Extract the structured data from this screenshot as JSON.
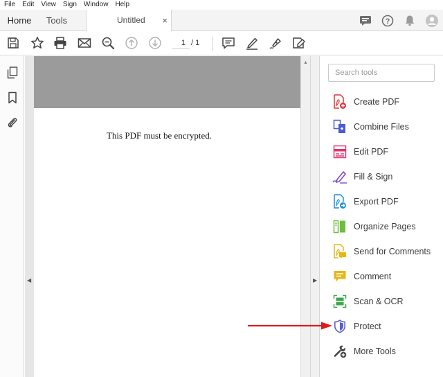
{
  "menu": [
    "File",
    "Edit",
    "View",
    "Sign",
    "Window",
    "Help"
  ],
  "tabs": {
    "home": "Home",
    "tools": "Tools",
    "document": "Untitled",
    "close": "×"
  },
  "header_icons": [
    "comment-bubble-icon",
    "help-icon",
    "bell-icon",
    "user-avatar-icon"
  ],
  "toolbar": {
    "icons": [
      "save-icon",
      "star-icon",
      "print-icon",
      "email-icon",
      "zoom-search-icon",
      "page-up-icon",
      "page-down-icon",
      "comment-icon",
      "highlight-pen-icon",
      "sign-pen-icon",
      "send-sign-icon"
    ],
    "page_current": "1",
    "page_total": "/ 1"
  },
  "left_nav_icons": [
    "page-thumbnails-icon",
    "bookmark-icon",
    "attachment-icon"
  ],
  "document": {
    "text": "This PDF must be encrypted."
  },
  "tools_pane": {
    "search_placeholder": "Search tools",
    "items": [
      {
        "label": "Create PDF",
        "icon": "create-pdf-icon",
        "color": "#e0353e"
      },
      {
        "label": "Combine Files",
        "icon": "combine-files-icon",
        "color": "#4a5bd6"
      },
      {
        "label": "Edit PDF",
        "icon": "edit-pdf-icon",
        "color": "#e0356e"
      },
      {
        "label": "Fill & Sign",
        "icon": "fill-sign-icon",
        "color": "#7c4bd6"
      },
      {
        "label": "Export PDF",
        "icon": "export-pdf-icon",
        "color": "#1b8fd6"
      },
      {
        "label": "Organize Pages",
        "icon": "organize-pages-icon",
        "color": "#6cbf3c"
      },
      {
        "label": "Send for Comments",
        "icon": "send-for-comments-icon",
        "color": "#e8b618"
      },
      {
        "label": "Comment",
        "icon": "comment-tool-icon",
        "color": "#e8b618"
      },
      {
        "label": "Scan & OCR",
        "icon": "scan-ocr-icon",
        "color": "#3aa84a"
      },
      {
        "label": "Protect",
        "icon": "protect-shield-icon",
        "color": "#5b5fc7"
      },
      {
        "label": "More Tools",
        "icon": "more-tools-icon",
        "color": "#444444"
      }
    ]
  },
  "annotation_color": "#e0191e"
}
